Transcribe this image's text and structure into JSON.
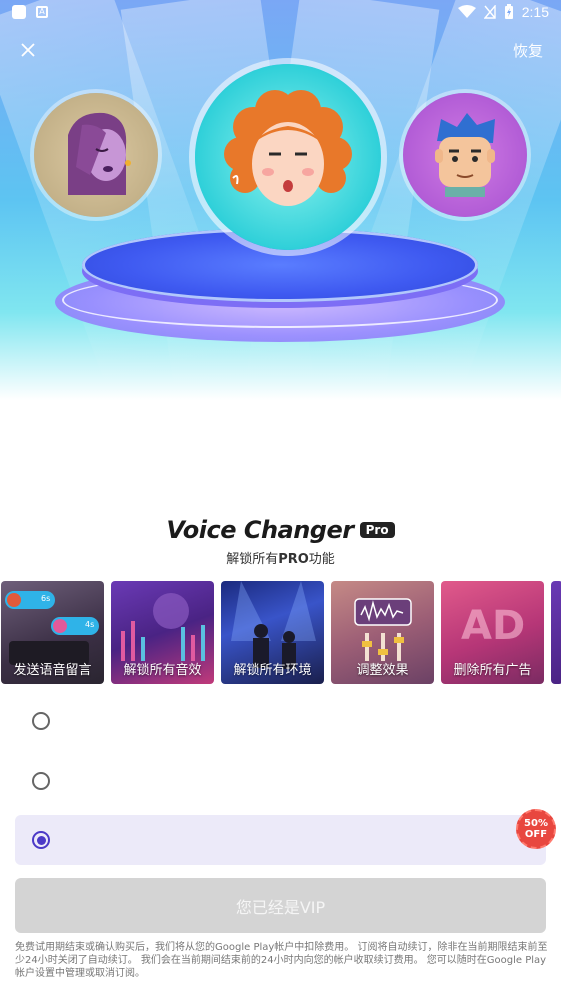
{
  "status_bar": {
    "time": "2:15",
    "icons": [
      "app-square-icon",
      "a-box-icon",
      "wifi-icon",
      "no-signal-icon",
      "battery-charging-icon"
    ]
  },
  "header": {
    "close_icon": "close-icon",
    "restore_label": "恢复"
  },
  "hero": {
    "avatars": [
      "woman-avatar",
      "curly-hair-girl-avatar",
      "man-avatar"
    ]
  },
  "title": {
    "app_name": "Voice Changer",
    "badge": "Pro",
    "subtitle_prefix": "解锁所有",
    "subtitle_bold": "PRO",
    "subtitle_suffix": "功能"
  },
  "features": [
    {
      "label": "发送语音留言"
    },
    {
      "label": "解锁所有音效"
    },
    {
      "label": "解锁所有环境"
    },
    {
      "label": "调整效果"
    },
    {
      "label": "删除所有广告"
    }
  ],
  "feature_card1_tags": [
    "6s",
    "4s"
  ],
  "feature_card5_overlay": "AD",
  "plans": [
    {
      "selected": false
    },
    {
      "selected": false
    },
    {
      "selected": true,
      "badge_line1": "50%",
      "badge_line2": "OFF"
    }
  ],
  "cta": {
    "label": "您已经是VIP"
  },
  "legal": {
    "text": "免费试用期结束或确认购买后，我们将从您的Google Play帐户中扣除费用。 订阅将自动续订，除非在当前期限结束前至少24小时关闭了自动续订。 我们会在当前期间结束前的24小时内向您的帐户收取续订费用。 您可以随时在Google Play帐户设置中管理或取消订阅。"
  },
  "colors": {
    "accent": "#4b39c7",
    "selected_plan_bg": "#eceaf9",
    "cta_disabled": "#d4d4d4",
    "discount_badge": "#e8473f"
  }
}
